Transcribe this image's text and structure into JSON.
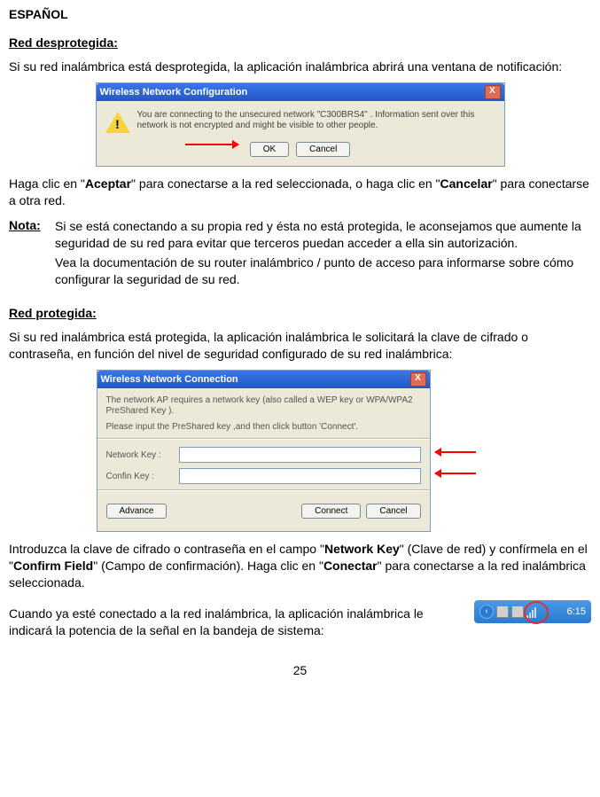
{
  "lang_header": "ESPAÑOL",
  "section1": {
    "title": "Red desprotegida:",
    "intro": "Si su red inalámbrica está desprotegida, la aplicación inalámbrica abrirá una ventana de notificación:",
    "after_pre": "Haga clic en \"",
    "after_b1": "Aceptar",
    "after_mid": "\" para conectarse a la red seleccionada, o haga clic en \"",
    "after_b2": "Cancelar",
    "after_post": "\" para conectarse a otra red.",
    "note_label": "Nota:",
    "note_p1": "Si se está conectando a su propia red y ésta no está protegida, le aconsejamos que aumente la seguridad de su red para evitar que terceros puedan acceder a ella sin autorización.",
    "note_p2": "Vea la documentación de su router inalámbrico / punto de acceso para informarse sobre cómo configurar la seguridad de su red."
  },
  "dialog1": {
    "title": "Wireless Network Configuration",
    "message": "You are connecting to the unsecured network \"C300BRS4\" . Information sent over this network is not encrypted and might be visible to other people.",
    "ok": "OK",
    "cancel": "Cancel",
    "close": "X"
  },
  "section2": {
    "title": "Red protegida:",
    "intro": "Si su red inalámbrica está protegida, la aplicación inalámbrica le solicitará la clave de cifrado o contraseña, en función del nivel de seguridad configurado de su red inalámbrica:",
    "after1_pre": "Introduzca la clave de cifrado o contraseña en el campo \"",
    "after1_b1": "Network Key",
    "after1_mid1": "\" (Clave de red) y confírmela en el \"",
    "after1_b2": "Confirm Field",
    "after1_mid2": "\" (Campo de confirmación). Haga clic en \"",
    "after1_b3": "Conectar",
    "after1_post": "\" para conectarse a la red inalámbrica seleccionada.",
    "after2": "Cuando ya esté conectado a la red inalámbrica, la aplicación inalámbrica le indicará la potencia de la señal en la bandeja de sistema:"
  },
  "dialog2": {
    "title": "Wireless Network Connection",
    "line1": "The network AP requires a network key (also called a WEP key or WPA/WPA2 PreShared Key ).",
    "line2": "Please input the PreShared key ,and then click button 'Connect'.",
    "label_key": "Network Key :",
    "label_confirm": "Confin Key :",
    "btn_advance": "Advance",
    "btn_connect": "Connect",
    "btn_cancel": "Cancel",
    "close": "X"
  },
  "tray": {
    "clock": "6:15",
    "chevron": "‹"
  },
  "page_number": "25"
}
